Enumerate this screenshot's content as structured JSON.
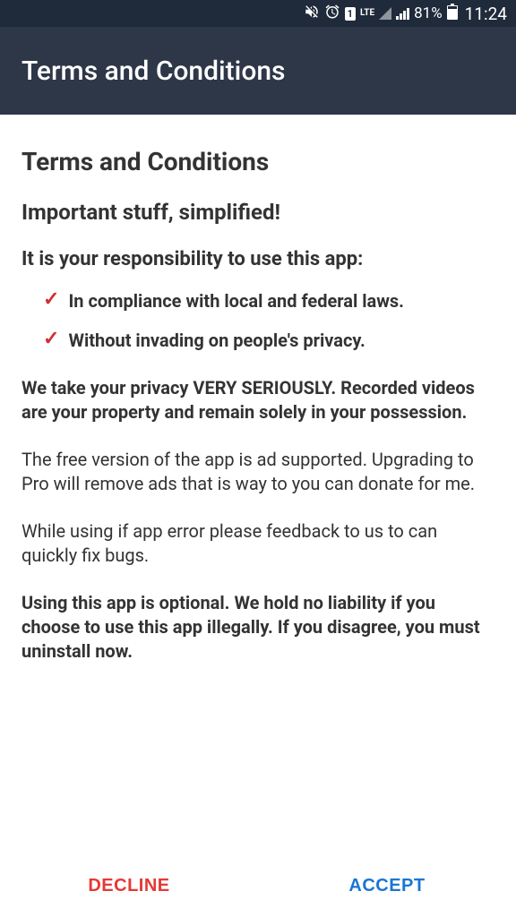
{
  "statusBar": {
    "lteLabel": "LTE",
    "battery": "81%",
    "time": "11:24",
    "simLabel": "1"
  },
  "appBar": {
    "title": "Terms and Conditions"
  },
  "content": {
    "heading1": "Terms and Conditions",
    "heading2": "Important stuff, simplified!",
    "heading3": "It is your responsibility to use this app:",
    "bullets": {
      "0": "In compliance with local and federal laws.",
      "1": "Without invading on people's privacy."
    },
    "privacyBold": "We take your privacy VERY SERIOUSLY. Recorded videos are your property and remain solely in your possession.",
    "freeVersion": "The free version of the app is ad supported. Upgrading to Pro will remove ads that is way to you can donate for me.",
    "feedback": "While using if app error please feedback to us to can quickly fix bugs.",
    "liability": "Using this app is optional. We hold no liability if you choose to use this app illegally. If you disagree, you must uninstall now."
  },
  "buttons": {
    "decline": "DECLINE",
    "accept": "ACCEPT"
  }
}
